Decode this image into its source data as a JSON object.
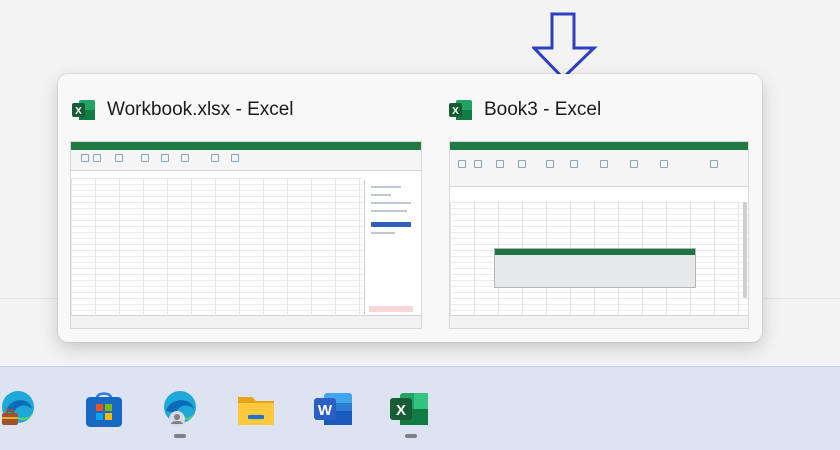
{
  "flyout": {
    "windows": [
      {
        "title": "Workbook.xlsx - Excel",
        "app_icon": "excel-icon"
      },
      {
        "title": "Book3 - Excel",
        "app_icon": "excel-icon"
      }
    ]
  },
  "taskbar": {
    "apps": [
      {
        "name": "edge-work-profile-icon"
      },
      {
        "name": "microsoft-store-icon"
      },
      {
        "name": "edge-profile-icon"
      },
      {
        "name": "file-explorer-icon"
      },
      {
        "name": "word-icon",
        "glyph": "W"
      },
      {
        "name": "excel-icon",
        "glyph": "X"
      }
    ]
  },
  "colors": {
    "excel": "#1f7a43",
    "arrow": "#2f3fbf",
    "word": "#2b5fc4"
  }
}
